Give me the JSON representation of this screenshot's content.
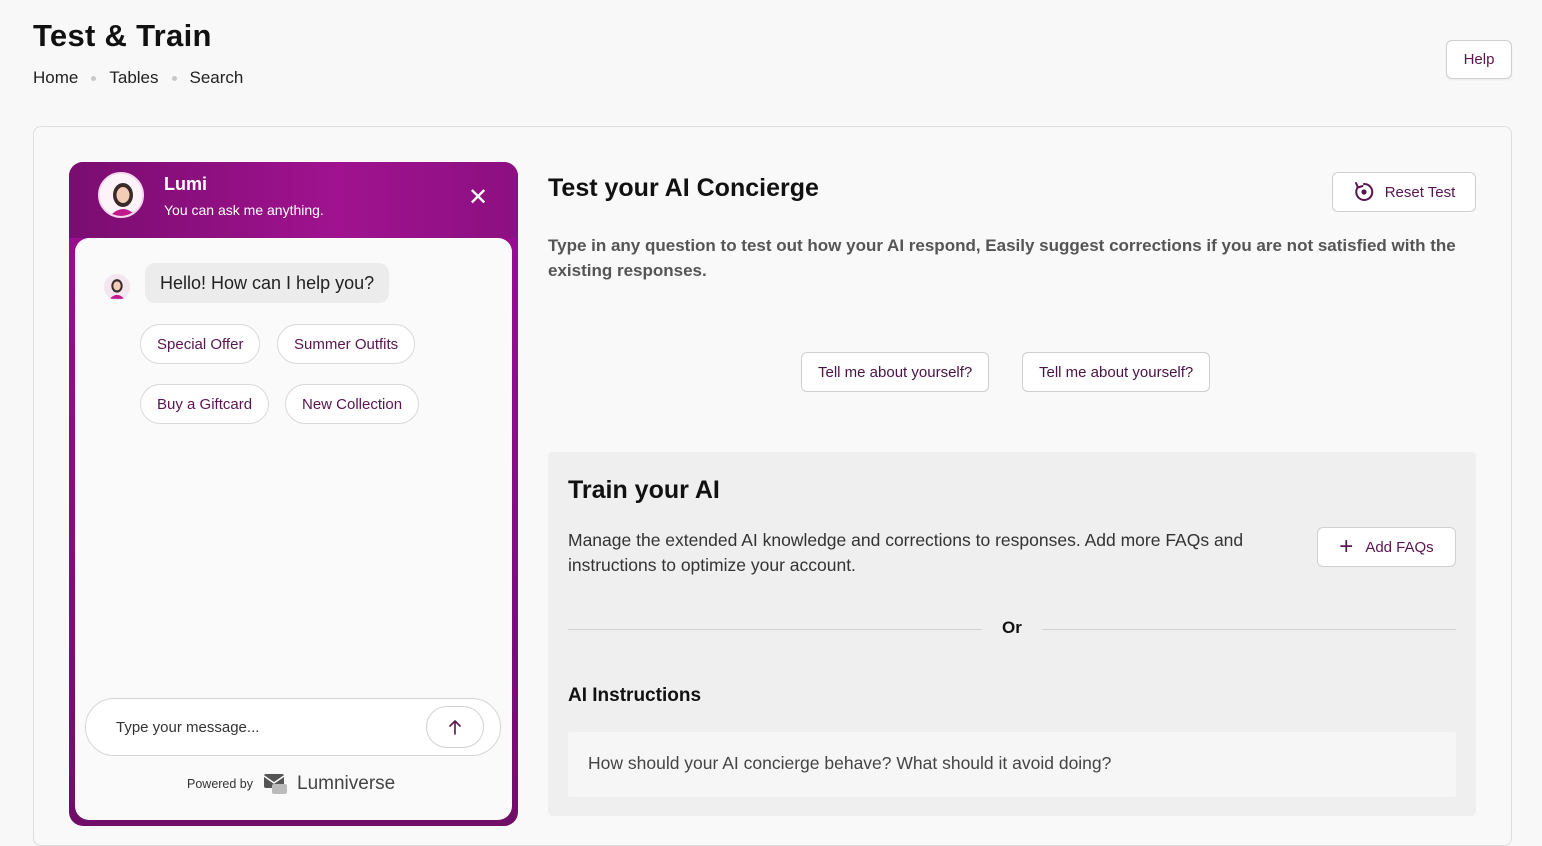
{
  "header": {
    "title": "Test & Train",
    "breadcrumb": [
      "Home",
      "Tables",
      "Search"
    ],
    "help_label": "Help"
  },
  "chat": {
    "bot_name": "Lumi",
    "bot_subtitle": "You can ask me anything.",
    "greeting": "Hello! How can I help you?",
    "quick_replies": [
      "Special Offer",
      "Summer Outfits",
      "Buy a Giftcard",
      "New Collection"
    ],
    "input_placeholder": "Type your message...",
    "powered_by": "Powered by",
    "brand": "Lumniverse",
    "accent_color": "#8a0f80"
  },
  "test": {
    "title": "Test your AI Concierge",
    "reset_label": "Reset Test",
    "description": "Type in any question to test out how your AI respond, Easily suggest corrections if you are not satisfied with the existing responses.",
    "suggestions": [
      "Tell me about yourself?",
      "Tell me about yourself?"
    ]
  },
  "train": {
    "title": "Train your AI",
    "description": "Manage the extended AI knowledge and corrections to responses. Add more FAQs and instructions to optimize your account.",
    "add_faqs_label": "Add FAQs",
    "or_label": "Or",
    "instructions_title": "AI Instructions",
    "instructions_placeholder": "How should your AI concierge behave? What should it avoid doing?"
  }
}
